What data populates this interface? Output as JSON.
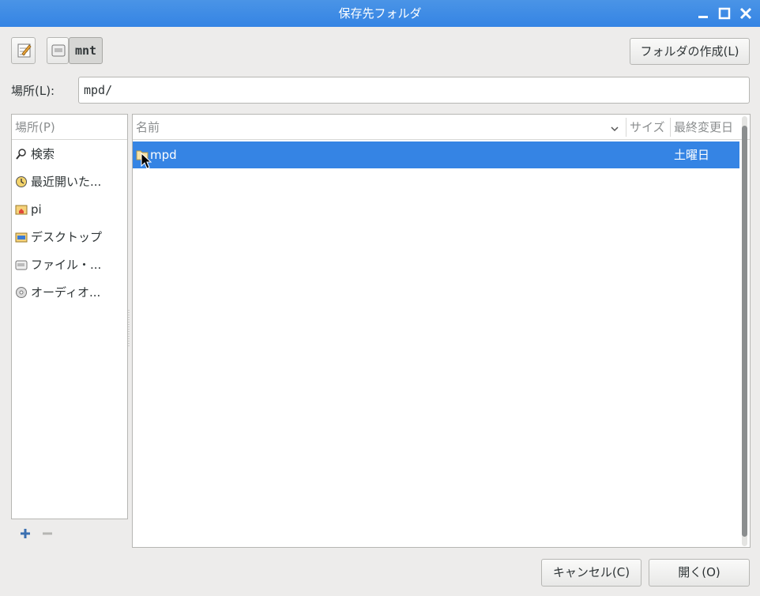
{
  "window": {
    "title": "保存先フォルダ"
  },
  "pathbar": {
    "current": "mnt"
  },
  "toolbar": {
    "create_folder_label": "フォルダの作成(L)"
  },
  "location": {
    "label": "場所(L):",
    "value": "mpd/"
  },
  "places": {
    "header": "場所(P)",
    "items": [
      {
        "label": "検索",
        "icon": "search-icon"
      },
      {
        "label": "最近開いた...",
        "icon": "recent-icon"
      },
      {
        "label": "pi",
        "icon": "home-folder-icon"
      },
      {
        "label": "デスクトップ",
        "icon": "desktop-icon"
      },
      {
        "label": "ファイル・...",
        "icon": "drive-icon"
      },
      {
        "label": "オーディオ...",
        "icon": "cd-icon"
      }
    ]
  },
  "files": {
    "columns": {
      "name": "名前",
      "size": "サイズ",
      "modified": "最終変更日"
    },
    "rows": [
      {
        "name": "mpd",
        "size": "",
        "modified": "土曜日",
        "selected": true
      }
    ]
  },
  "buttons": {
    "cancel": "キャンセル(C)",
    "open": "開く(O)"
  },
  "colors": {
    "accent": "#3584e4",
    "titlebar": "#3584e4",
    "background": "#edeceb"
  }
}
